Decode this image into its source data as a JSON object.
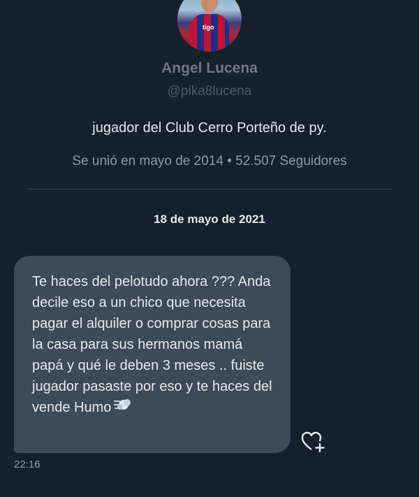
{
  "profile": {
    "name": "Angel Lucena",
    "handle": "@pika8lucena",
    "bio": "jugador del Club Cerro Porteño de py.",
    "meta": "Se unió en mayo de 2014 • 52.507 Seguidores",
    "avatar_sponsor": "tigo"
  },
  "conversation": {
    "date": "18 de mayo de 2021",
    "message_text": "Te haces del pelotudo ahora ??? Anda decile eso a un chico que necesita pagar el alquiler o comprar cosas para la casa para sus hermanos mamá papá y qué le deben 3 meses .. fuiste jugador pasaste por eso y te haces del vende Humo",
    "message_emoji": "dashing-away-icon",
    "timestamp": "22:16",
    "react_icon": "heart-plus-icon"
  },
  "colors": {
    "background": "#15202b",
    "bubble": "#3e4a56",
    "muted": "#8b98a5",
    "text": "#e7e9ea"
  }
}
